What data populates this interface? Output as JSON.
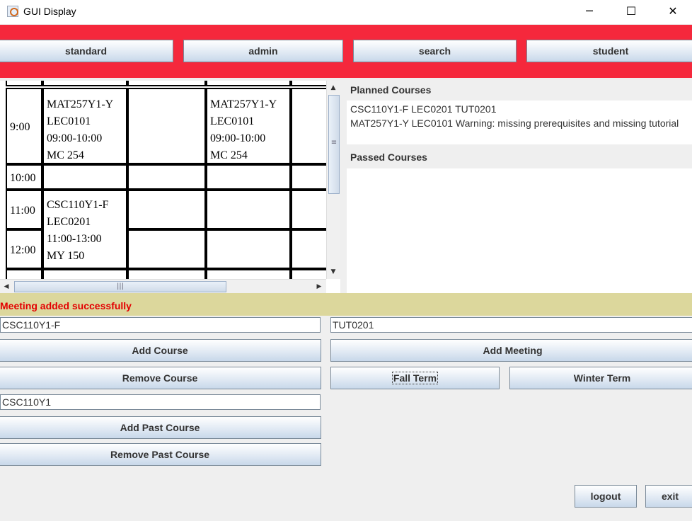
{
  "window": {
    "title": "GUI Display",
    "minimize_glyph": "─",
    "maximize_glyph": "☐",
    "close_glyph": "✕"
  },
  "nav": {
    "standard": "standard",
    "admin": "admin",
    "search": "search",
    "student": "student"
  },
  "schedule": {
    "rows": [
      {
        "time": "9:00"
      },
      {
        "time": "10:00"
      },
      {
        "time": "11:00"
      },
      {
        "time": "12:00"
      }
    ],
    "meetings": [
      {
        "code": "MAT257Y1-Y",
        "section": "LEC0101",
        "time": "09:00-10:00",
        "room": "MC 254"
      },
      {
        "code": "MAT257Y1-Y",
        "section": "LEC0101",
        "time": "09:00-10:00",
        "room": "MC 254"
      },
      {
        "code": "CSC110Y1-F",
        "section": "LEC0201",
        "time": "11:00-13:00",
        "room": "MY 150"
      }
    ],
    "scroll_up": "▲",
    "scroll_down": "▼",
    "scroll_left": "◀",
    "scroll_right": "▶",
    "v_grip": "≡",
    "h_grip": "|||"
  },
  "planned": {
    "label": "Planned Courses",
    "lines": [
      "CSC110Y1-F LEC0201 TUT0201",
      "MAT257Y1-Y LEC0101 Warning: missing prerequisites and missing tutorial"
    ]
  },
  "passed": {
    "label": "Passed Courses"
  },
  "status": {
    "message": "Meeting added successfully",
    "color": "#e30000"
  },
  "form": {
    "course_code_value": "CSC110Y1-F",
    "meeting_value": "TUT0201",
    "add_course": "Add Course",
    "add_meeting": "Add Meeting",
    "remove_course": "Remove Course",
    "fall_term": "Fall Term",
    "winter_term": "Winter Term",
    "past_course_value": "CSC110Y1",
    "add_past_course": "Add Past Course",
    "remove_past_course": "Remove Past Course",
    "logout": "logout",
    "exit": "exit"
  },
  "colors": {
    "header_bar": "#f5283c",
    "status_bar": "#dcd79c"
  }
}
